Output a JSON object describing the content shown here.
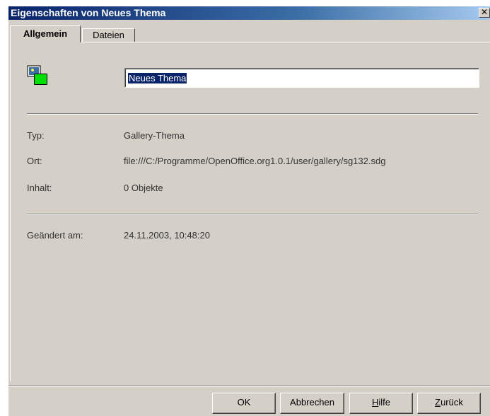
{
  "window": {
    "title": "Eigenschaften von Neues Thema"
  },
  "tabs": [
    {
      "label": "Allgemein",
      "active": true
    },
    {
      "label": "Dateien",
      "active": false
    }
  ],
  "name_field": {
    "value": "Neues Thema"
  },
  "info": {
    "type_label": "Typ:",
    "type_value": "Gallery-Thema",
    "location_label": "Ort:",
    "location_value": "file:///C:/Programme/OpenOffice.org1.0.1/user/gallery/sg132.sdg",
    "content_label": "Inhalt:",
    "content_value": "0 Objekte",
    "modified_label": "Geändert am:",
    "modified_value": "24.11.2003, 10:48:20"
  },
  "buttons": {
    "ok": "OK",
    "cancel": "Abbrechen",
    "help_mnemonic": "H",
    "help_rest": "ilfe",
    "back_mnemonic": "Z",
    "back_rest": "urück"
  },
  "icons": {
    "close": "close-icon",
    "theme": "gallery-theme-icon"
  },
  "colors": {
    "titlebar": "#0a246a",
    "dialog_bg": "#d4d0c8",
    "selection": "#0a246a"
  }
}
